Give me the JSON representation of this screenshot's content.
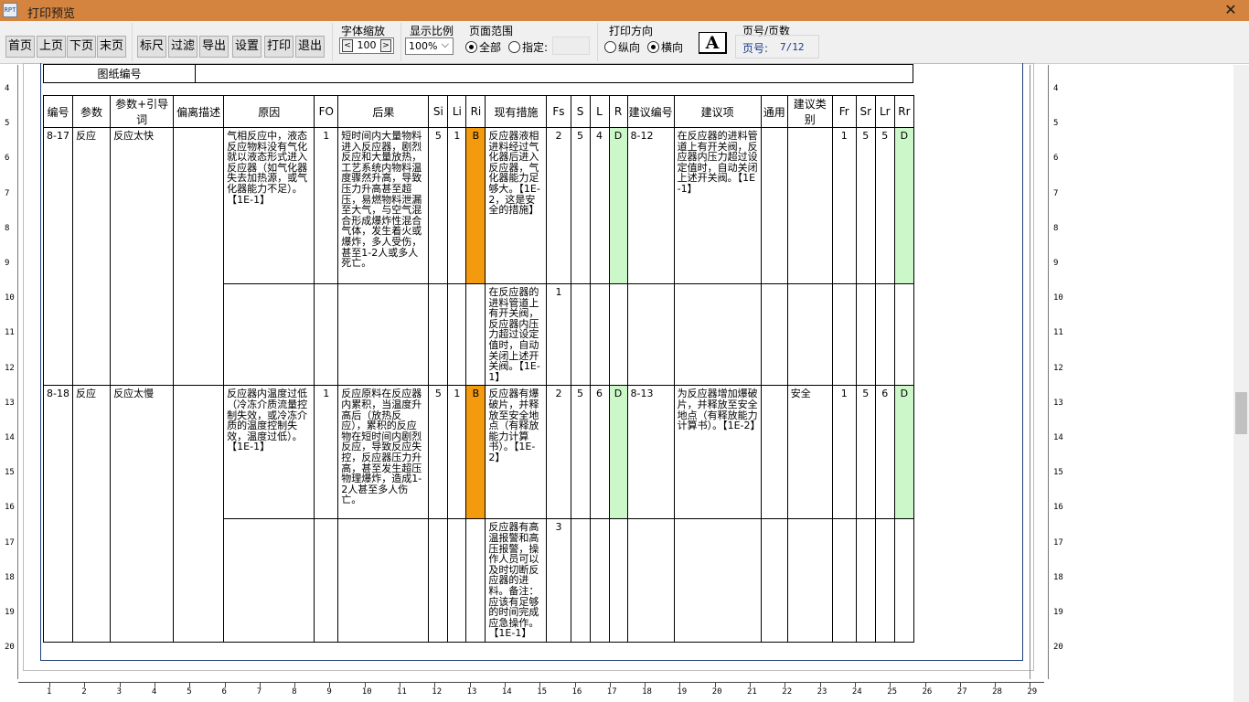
{
  "window": {
    "icon_text": "RPT",
    "title": "打印预览",
    "close_glyph": "✕"
  },
  "toolbar": {
    "buttons": [
      "首页",
      "上页",
      "下页",
      "末页",
      "标尺",
      "过滤",
      "导出",
      "设置",
      "打印",
      "退出"
    ],
    "font_zoom": {
      "label": "字体缩放",
      "value": "100",
      "dec": "<",
      "inc": ">"
    },
    "display_ratio": {
      "label": "显示比例",
      "value": "100%",
      "arrow": "⌵"
    },
    "page_range": {
      "label": "页面范围",
      "all": "全部",
      "specified": "指定:",
      "value": ""
    },
    "orientation": {
      "label": "打印方向",
      "portrait": "纵向",
      "landscape": "横向"
    },
    "font_icon": "A",
    "page_info": {
      "label": "页号/页数",
      "prefix": "页号:",
      "value": "7/12"
    }
  },
  "ruler": {
    "vertical": [
      "4",
      "5",
      "6",
      "7",
      "8",
      "9",
      "10",
      "11",
      "12",
      "13",
      "14",
      "15",
      "16",
      "17",
      "18",
      "19",
      "20"
    ],
    "horizontal": [
      "1",
      "2",
      "3",
      "4",
      "5",
      "6",
      "7",
      "8",
      "9",
      "10",
      "11",
      "12",
      "13",
      "14",
      "15",
      "16",
      "17",
      "18",
      "19",
      "20",
      "21",
      "22",
      "23",
      "24",
      "25",
      "26",
      "27",
      "28",
      "29"
    ]
  },
  "sheet": {
    "drawing_number_label": "图纸编号",
    "columns": [
      "编号",
      "参数",
      "参数+引导词",
      "偏离描述",
      "原因",
      "FO",
      "后果",
      "Si",
      "Li",
      "Ri",
      "现有措施",
      "Fs",
      "S",
      "L",
      "R",
      "建议编号",
      "建议项",
      "通用",
      "建议类别",
      "Fr",
      "Sr",
      "Lr",
      "Rr"
    ],
    "records": [
      {
        "id": "8-17",
        "param": "反应",
        "guideword": "反应太快",
        "deviation": "",
        "cause": "气相反应中，液态反应物料没有气化就以液态形式进入反应器（如气化器失去加热源，或气化器能力不足）。【1E-1】",
        "fo": "1",
        "consequence": "短时间内大量物料进入反应器，剧烈反应和大量放热，工艺系统内物料温度骤然升高，导致压力升高甚至超压，易燃物料泄漏至大气，与空气混合形成爆炸性混合气体，发生着火或爆炸，多人受伤，甚至1-2人或多人死亡。",
        "si": "5",
        "li": "1",
        "ri": "B",
        "measure1": "反应器液相进料经过气化器后进入反应器，气化器能力足够大。【1E-2，这是安全的措施】",
        "fs1": "2",
        "measure2": "在反应器的进料管道上有开关阀，反应器内压力超过设定值时，自动关闭上述开关阀。【1E-1】",
        "fs2": "1",
        "s": "5",
        "l": "4",
        "r": "D",
        "sugg_no": "8-12",
        "suggestion": "在反应器的进料管道上有开关阀，反应器内压力超过设定值时，自动关闭上述开关阀。【1E-1】",
        "general": "",
        "category": "",
        "fr": "1",
        "sr": "5",
        "lr": "5",
        "rr": "D"
      },
      {
        "id": "8-18",
        "param": "反应",
        "guideword": "反应太慢",
        "deviation": "",
        "cause": "反应器内温度过低（冷冻介质流量控制失效，或冷冻介质的温度控制失效，温度过低）。【1E-1】",
        "fo": "1",
        "consequence": "反应原料在反应器内累积，当温度升高后（放热反应），累积的反应物在短时间内剧烈反应，导致反应失控，反应器压力升高，甚至发生超压物理爆炸，造成1-2人甚至多人伤亡。",
        "si": "5",
        "li": "1",
        "ri": "B",
        "measure1": "反应器有爆破片，并释放至安全地点（有释放能力计算书）。【1E-2】",
        "fs1": "2",
        "measure2": "反应器有高温报警和高压报警，操作人员可以及时切断反应器的进料。备注：应该有足够的时间完成应急操作。【1E-1】",
        "fs2": "3",
        "s": "5",
        "l": "6",
        "r": "D",
        "sugg_no": "8-13",
        "suggestion": "为反应器增加爆破片，并释放至安全地点（有释放能力计算书）。【1E-2】",
        "general": "",
        "category": "安全",
        "fr": "1",
        "sr": "5",
        "lr": "6",
        "rr": "D"
      }
    ]
  },
  "colors": {
    "titlebar": "#d4843f",
    "ri_cell": "#f39a0f",
    "rr_cell": "#ccf7c8",
    "page_link": "#1a3a8a"
  }
}
